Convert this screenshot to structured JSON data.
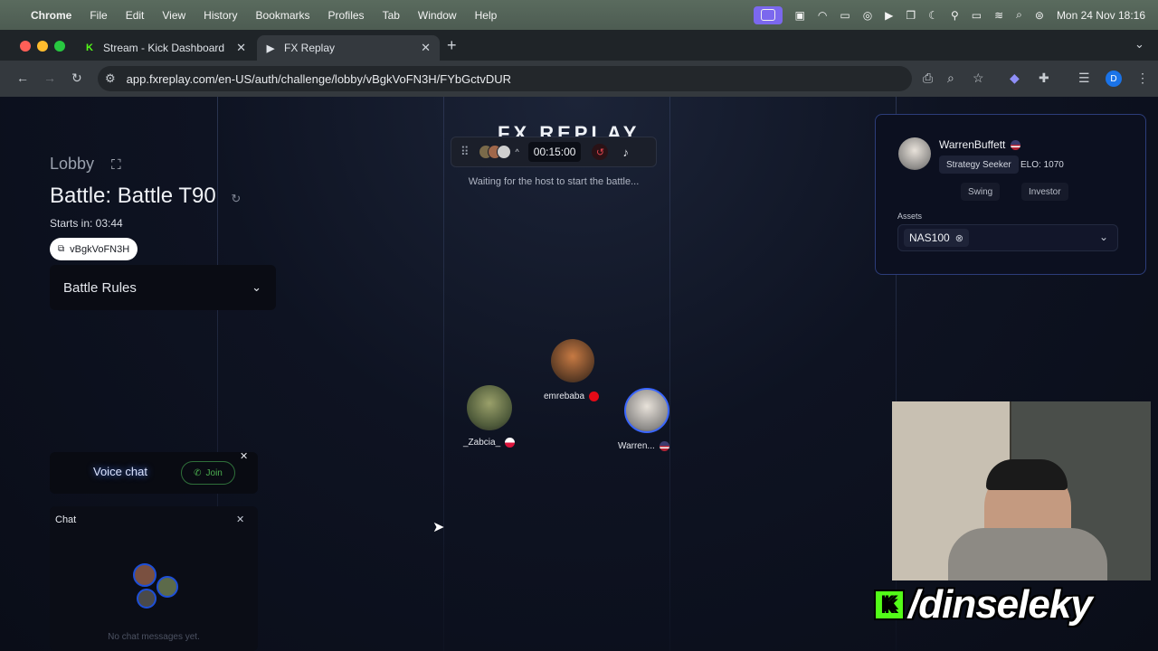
{
  "menubar": {
    "app": "Chrome",
    "items": [
      "File",
      "Edit",
      "View",
      "History",
      "Bookmarks",
      "Profiles",
      "Tab",
      "Window",
      "Help"
    ],
    "clock": "Mon 24 Nov  18:16"
  },
  "tabs": [
    {
      "label": "Stream - Kick Dashboard",
      "icon": "kick-icon"
    },
    {
      "label": "FX Replay",
      "icon": "fxreplay-icon"
    }
  ],
  "address": {
    "url": "app.fxreplay.com/en-US/auth/challenge/lobby/vBgkVoFN3H/FYbGctvDUR",
    "profile_initial": "D"
  },
  "header": {
    "logo": "FX REPLAY",
    "timer": "00:15:00",
    "waiting": "Waiting for the host to start the battle..."
  },
  "lobby": {
    "label": "Lobby",
    "battle_title": "Battle: Battle T90",
    "starts_in": "Starts in: 03:44",
    "code": "vBgkVoFN3H",
    "rules_label": "Battle Rules"
  },
  "profile": {
    "name": "WarrenBuffett",
    "badge": "Strategy Seeker",
    "elo": "ELO: 1070",
    "tags": [
      "Swing",
      "Investor"
    ],
    "assets_label": "Assets",
    "asset": "NAS100"
  },
  "players": [
    {
      "name": "emrebaba",
      "flag": "tr"
    },
    {
      "name": "_Zabcia_",
      "flag": "pl"
    },
    {
      "name": "Warren...",
      "flag": "us"
    }
  ],
  "voice": {
    "title": "Voice chat",
    "join_label": "Join"
  },
  "chat": {
    "title": "Chat",
    "empty": "No chat messages yet."
  },
  "stream": {
    "handle": "/dinseleky"
  },
  "colors": {
    "accent": "#2c3d7a",
    "join_green": "#4caf50",
    "kick_green": "#53fc18"
  }
}
